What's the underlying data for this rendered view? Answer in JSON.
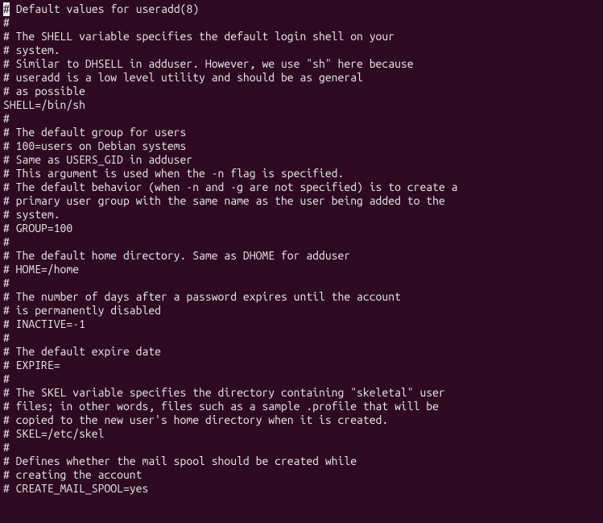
{
  "lines": [
    "# Default values for useradd(8)",
    "#",
    "# The SHELL variable specifies the default login shell on your",
    "# system.",
    "# Similar to DHSELL in adduser. However, we use \"sh\" here because",
    "# useradd is a low level utility and should be as general",
    "# as possible",
    "SHELL=/bin/sh",
    "#",
    "# The default group for users",
    "# 100=users on Debian systems",
    "# Same as USERS_GID in adduser",
    "# This argument is used when the -n flag is specified.",
    "# The default behavior (when -n and -g are not specified) is to create a",
    "# primary user group with the same name as the user being added to the",
    "# system.",
    "# GROUP=100",
    "#",
    "# The default home directory. Same as DHOME for adduser",
    "# HOME=/home",
    "#",
    "# The number of days after a password expires until the account",
    "# is permanently disabled",
    "# INACTIVE=-1",
    "#",
    "# The default expire date",
    "# EXPIRE=",
    "#",
    "# The SKEL variable specifies the directory containing \"skeletal\" user",
    "# files; in other words, files such as a sample .profile that will be",
    "# copied to the new user's home directory when it is created.",
    "# SKEL=/etc/skel",
    "#",
    "# Defines whether the mail spool should be created while",
    "# creating the account",
    "# CREATE_MAIL_SPOOL=yes"
  ],
  "cursor_line": 0,
  "cursor_col": 0
}
